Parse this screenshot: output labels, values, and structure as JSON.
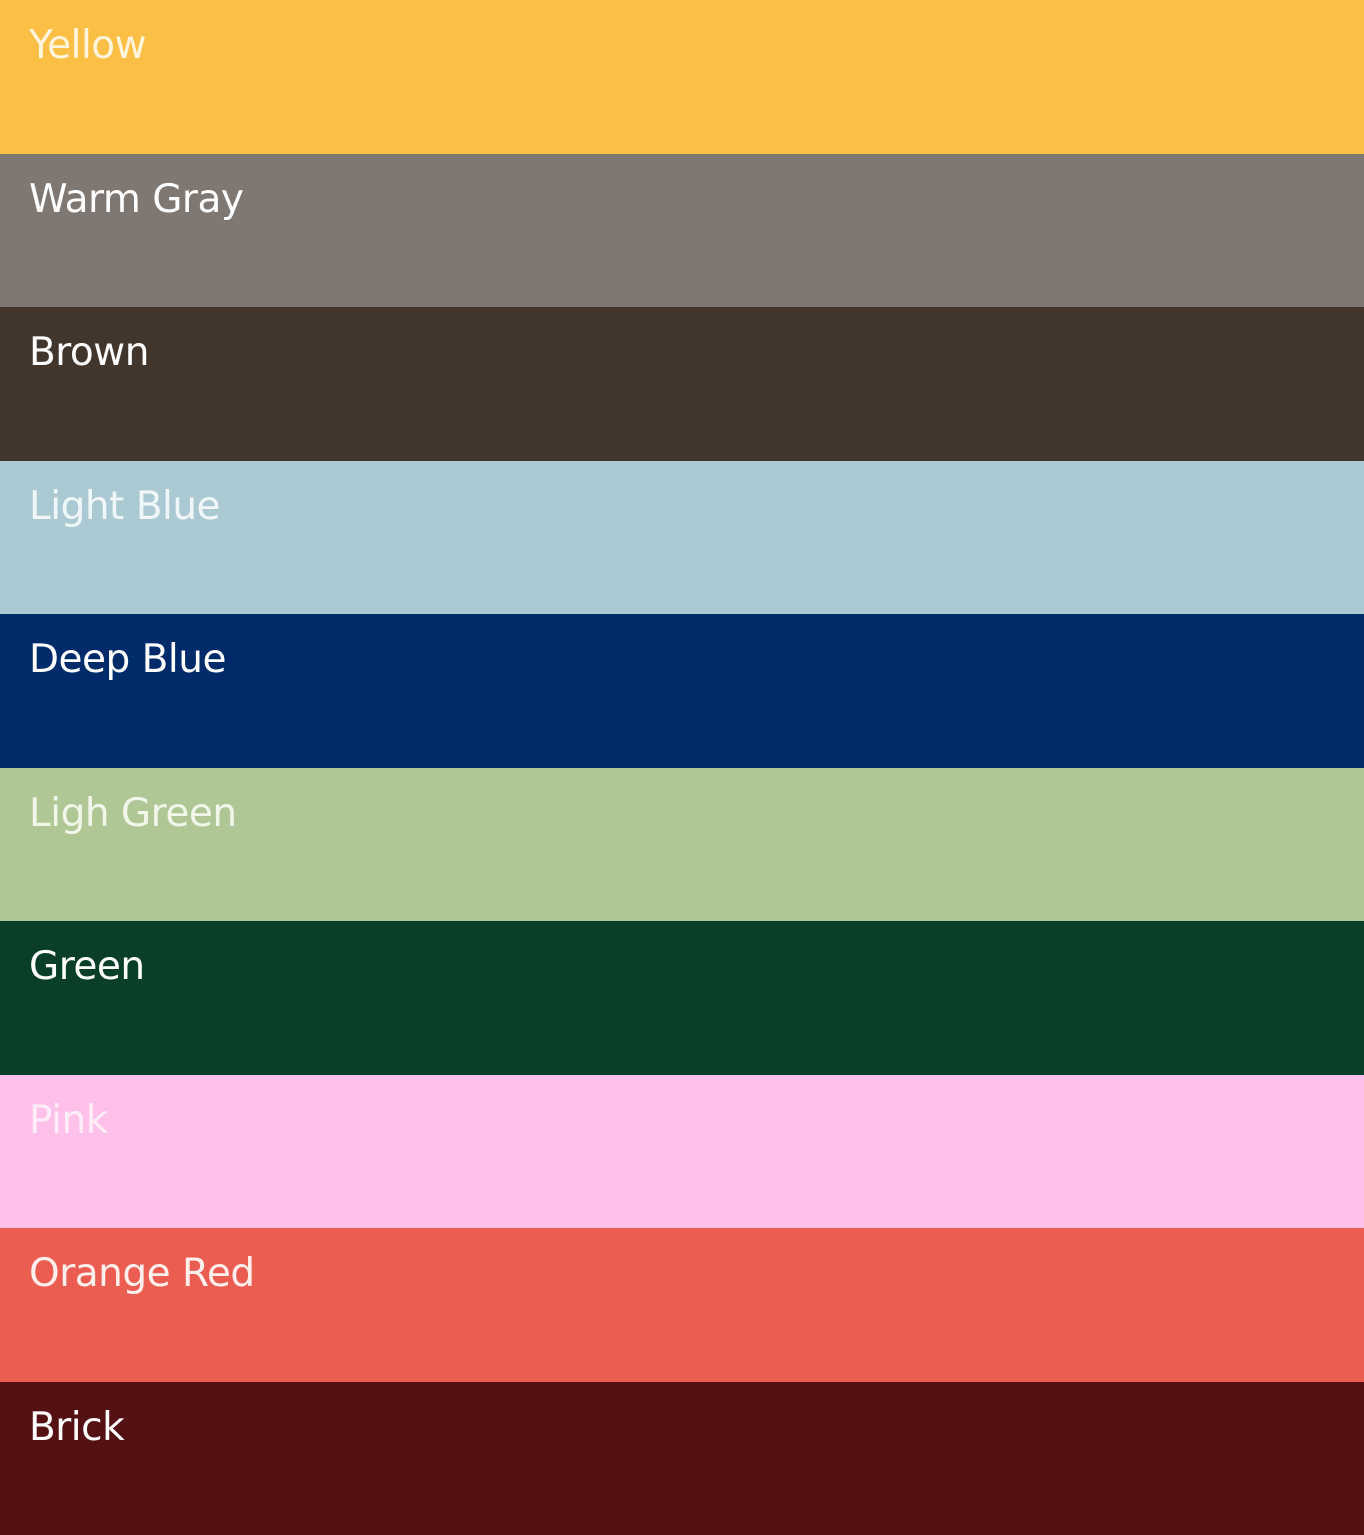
{
  "swatches": [
    {
      "label": "Yellow",
      "color": "#FCBF46",
      "text_color": "#FFF4DC"
    },
    {
      "label": "Warm Gray",
      "color": "#7F7771",
      "text_color": "#FFFFFF"
    },
    {
      "label": "Brown",
      "color": "#42362C",
      "text_color": "#FFFFFF"
    },
    {
      "label": "Light Blue",
      "color": "#AAC9D3",
      "text_color": "#F1F6F8"
    },
    {
      "label": "Deep Blue",
      "color": "#002B6A",
      "text_color": "#FFFFFF"
    },
    {
      "label": "Ligh Green",
      "color": "#AEC794",
      "text_color": "#F1F6EB"
    },
    {
      "label": "Green",
      "color": "#093F28",
      "text_color": "#FFFFFF"
    },
    {
      "label": "Pink",
      "color": "#FFC1EA",
      "text_color": "#FFEDF8"
    },
    {
      "label": "Orange Red",
      "color": "#EB5D51",
      "text_color": "#FFF0EE"
    },
    {
      "label": "Brick",
      "color": "#541013",
      "text_color": "#FFFFFF"
    }
  ]
}
